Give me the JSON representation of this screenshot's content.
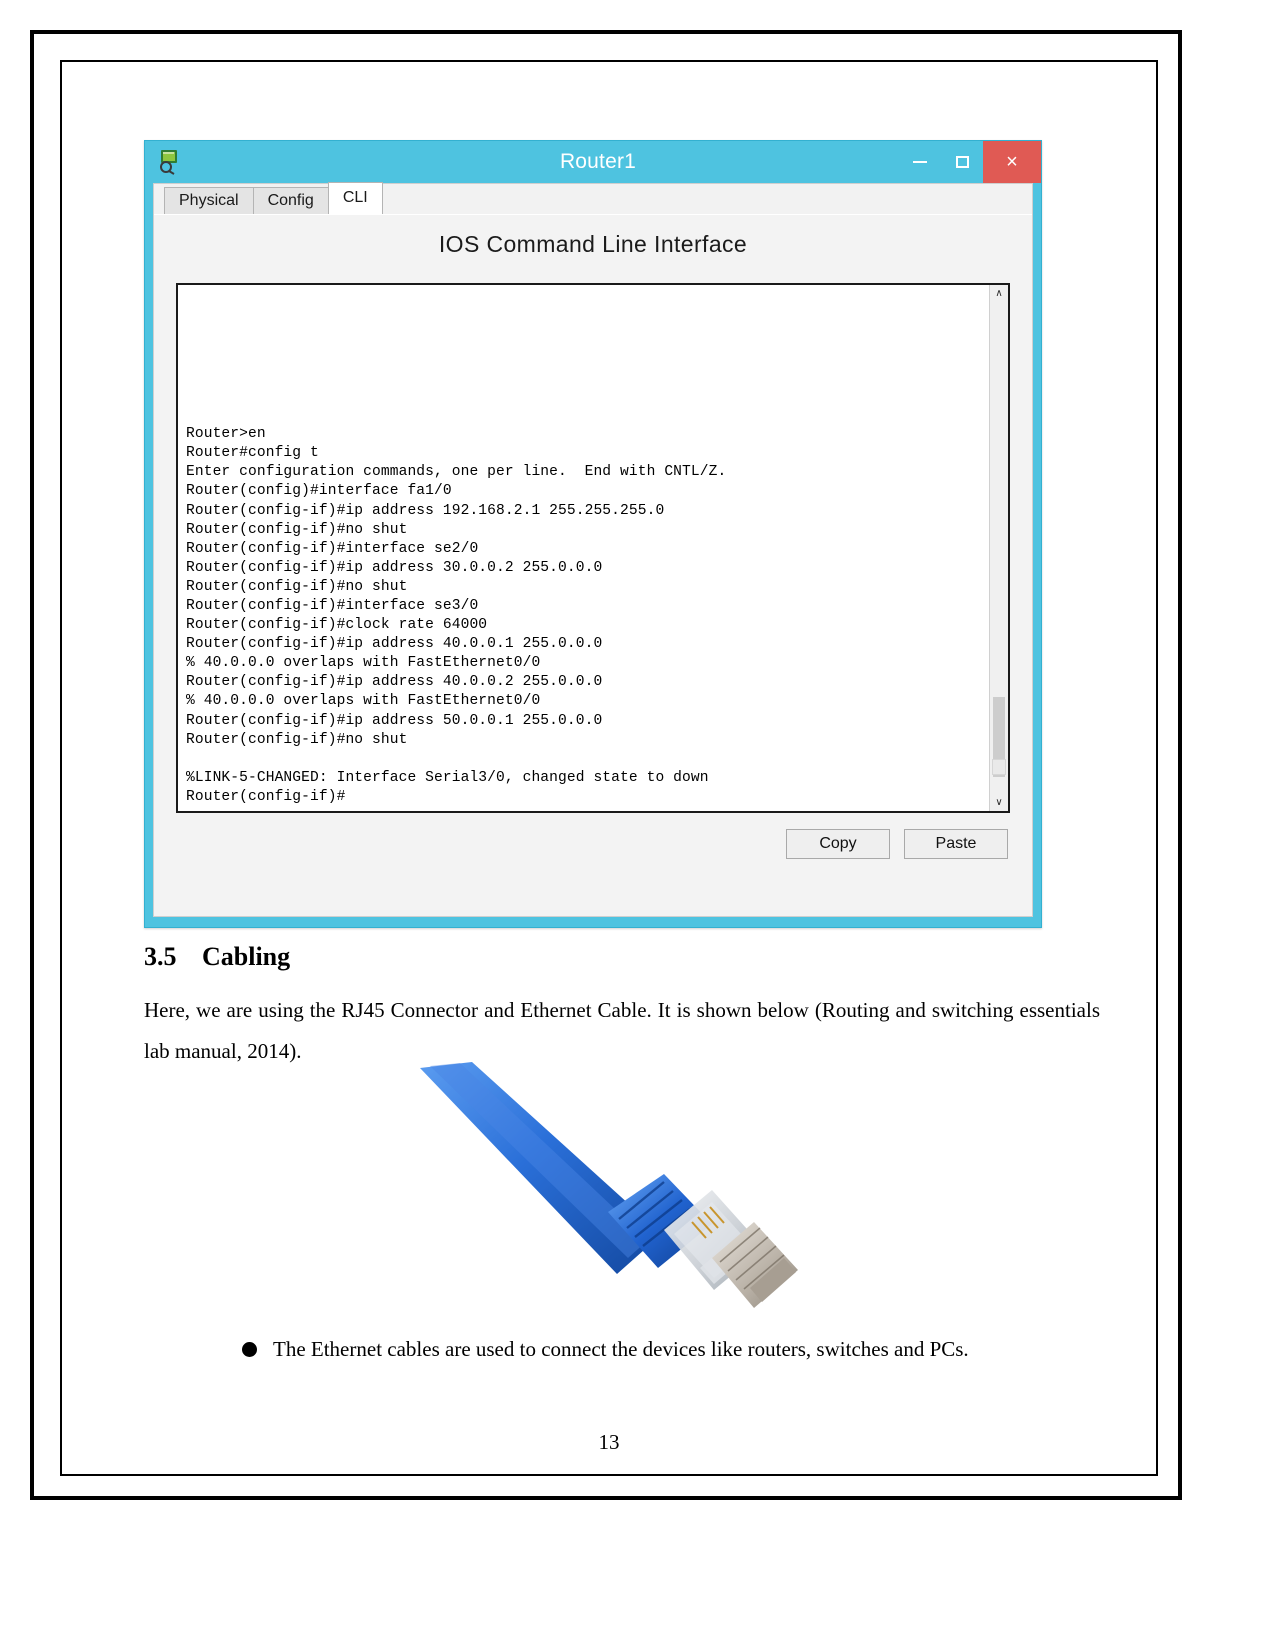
{
  "window": {
    "title": "Router1",
    "icon": "packet-tracer-router-icon",
    "controls": {
      "minimize": "–",
      "maximize": "□",
      "close": "×"
    },
    "tabs": [
      {
        "label": "Physical",
        "active": false
      },
      {
        "label": "Config",
        "active": false
      },
      {
        "label": "CLI",
        "active": true
      }
    ],
    "panel_heading": "IOS Command Line Interface",
    "buttons": {
      "copy": "Copy",
      "paste": "Paste"
    },
    "scrollbar": {
      "up_arrow": "∧",
      "down_arrow": "∨"
    }
  },
  "terminal": {
    "lines": [
      "Router>en",
      "Router#config t",
      "Enter configuration commands, one per line.  End with CNTL/Z.",
      "Router(config)#interface fa1/0",
      "Router(config-if)#ip address 192.168.2.1 255.255.255.0",
      "Router(config-if)#no shut",
      "Router(config-if)#interface se2/0",
      "Router(config-if)#ip address 30.0.0.2 255.0.0.0",
      "Router(config-if)#no shut",
      "Router(config-if)#interface se3/0",
      "Router(config-if)#clock rate 64000",
      "Router(config-if)#ip address 40.0.0.1 255.0.0.0",
      "% 40.0.0.0 overlaps with FastEthernet0/0",
      "Router(config-if)#ip address 40.0.0.2 255.0.0.0",
      "% 40.0.0.0 overlaps with FastEthernet0/0",
      "Router(config-if)#ip address 50.0.0.1 255.0.0.0",
      "Router(config-if)#no shut",
      "",
      "%LINK-5-CHANGED: Interface Serial3/0, changed state to down",
      "Router(config-if)#"
    ]
  },
  "document": {
    "section_number": "3.5",
    "section_title": "Cabling",
    "paragraph": "Here, we are using the RJ45 Connector and Ethernet Cable. It is shown below (Routing and switching essentials lab manual, 2014).",
    "figure_caption_bullet": "The Ethernet cables are used to connect the devices like routers, switches and PCs.",
    "page_number": "13"
  },
  "colors": {
    "titlebar": "#4ec3e0",
    "close_button": "#e05a54",
    "cable_blue": "#1c63c8",
    "cable_blue_light": "#4f93ea",
    "connector_clear": "#cfd4d8"
  }
}
